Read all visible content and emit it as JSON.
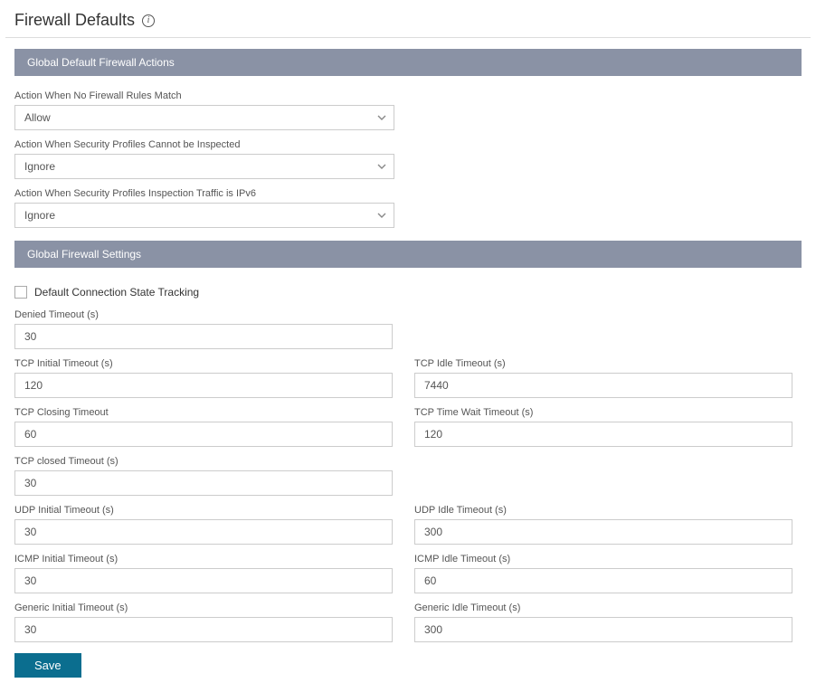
{
  "page": {
    "title": "Firewall Defaults"
  },
  "sections": {
    "actions": {
      "header": "Global Default Firewall Actions",
      "fields": {
        "no_match": {
          "label": "Action When No Firewall Rules Match",
          "value": "Allow"
        },
        "cannot_inspect": {
          "label": "Action When Security Profiles Cannot be Inspected",
          "value": "Ignore"
        },
        "ipv6": {
          "label": "Action When Security Profiles Inspection Traffic is IPv6",
          "value": "Ignore"
        }
      }
    },
    "settings": {
      "header": "Global Firewall Settings",
      "checkbox": {
        "label": "Default Connection State Tracking",
        "checked": false
      },
      "fields": {
        "denied_timeout": {
          "label": "Denied Timeout (s)",
          "value": "30"
        },
        "tcp_initial_timeout": {
          "label": "TCP Initial Timeout (s)",
          "value": "120"
        },
        "tcp_idle_timeout": {
          "label": "TCP Idle Timeout (s)",
          "value": "7440"
        },
        "tcp_closing_timeout": {
          "label": "TCP Closing Timeout",
          "value": "60"
        },
        "tcp_time_wait_timeout": {
          "label": "TCP Time Wait Timeout (s)",
          "value": "120"
        },
        "tcp_closed_timeout": {
          "label": "TCP closed Timeout (s)",
          "value": "30"
        },
        "udp_initial_timeout": {
          "label": "UDP Initial Timeout (s)",
          "value": "30"
        },
        "udp_idle_timeout": {
          "label": "UDP Idle Timeout (s)",
          "value": "300"
        },
        "icmp_initial_timeout": {
          "label": "ICMP Initial Timeout (s)",
          "value": "30"
        },
        "icmp_idle_timeout": {
          "label": "ICMP Idle Timeout (s)",
          "value": "60"
        },
        "generic_initial_timeout": {
          "label": "Generic Initial Timeout (s)",
          "value": "30"
        },
        "generic_idle_timeout": {
          "label": "Generic Idle Timeout (s)",
          "value": "300"
        }
      }
    }
  },
  "buttons": {
    "save": "Save"
  }
}
